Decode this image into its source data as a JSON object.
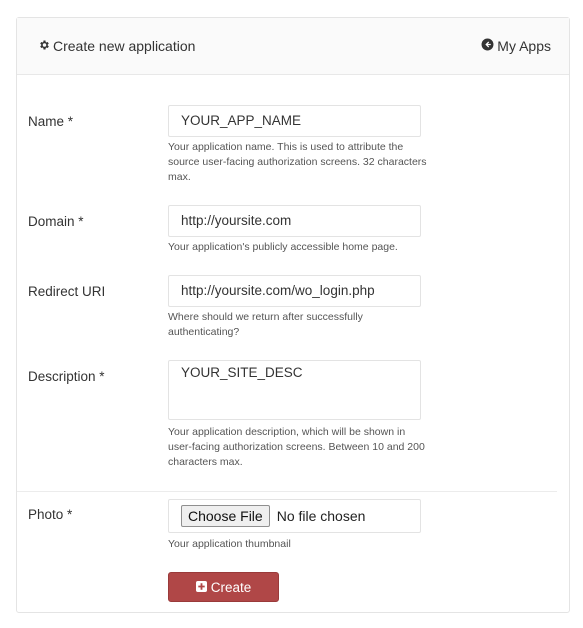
{
  "header": {
    "title": "Create new application",
    "my_apps_label": "My Apps"
  },
  "form": {
    "name": {
      "label": "Name *",
      "value": "YOUR_APP_NAME",
      "help": "Your application name. This is used to attribute the source user-facing authorization screens. 32 characters max."
    },
    "domain": {
      "label": "Domain *",
      "value": "http://yoursite.com",
      "help": "Your application's publicly accessible home page."
    },
    "redirect": {
      "label": "Redirect URI",
      "value": "http://yoursite.com/wo_login.php",
      "help": "Where should we return after successfully authenticating?"
    },
    "description": {
      "label": "Description *",
      "value": "YOUR_SITE_DESC",
      "help": "Your application description, which will be shown in user-facing authorization screens. Between 10 and 200 characters max."
    },
    "photo": {
      "label": "Photo *",
      "choose_label": "Choose File",
      "status": "No file chosen",
      "help": "Your application thumbnail"
    },
    "create_label": "Create"
  },
  "colors": {
    "create_button": "#b04747",
    "header_bg": "#fafafa"
  }
}
